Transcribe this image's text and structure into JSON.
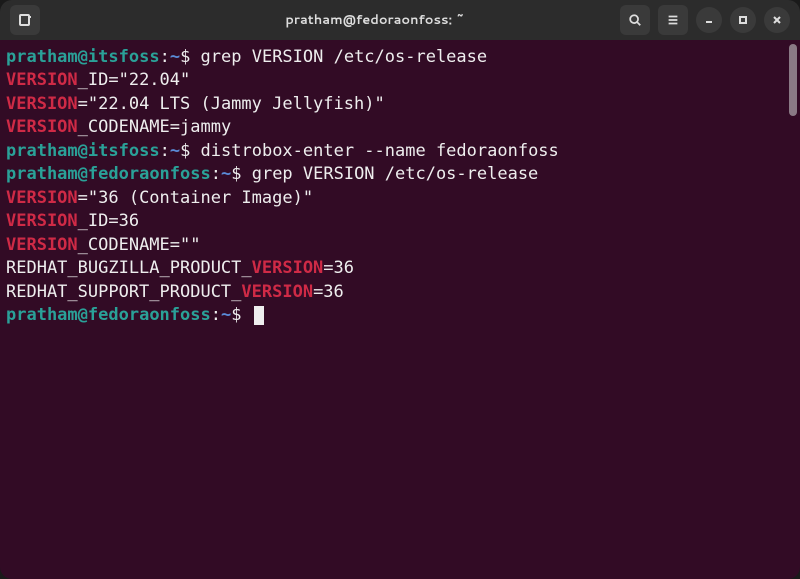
{
  "titlebar": {
    "title": "pratham@fedoraonfoss: ~"
  },
  "prompts": {
    "p1": {
      "user": "pratham",
      "at": "@",
      "host": "itsfoss",
      "colon": ":",
      "path": "~",
      "dollar": "$"
    },
    "p2": {
      "user": "pratham",
      "at": "@",
      "host": "fedoraonfoss",
      "colon": ":",
      "path": "~",
      "dollar": "$"
    }
  },
  "commands": {
    "cmd1": " grep VERSION /etc/os-release",
    "cmd2": " distrobox-enter --name fedoraonfoss",
    "cmd3": " grep VERSION /etc/os-release",
    "cmd4": " "
  },
  "output": {
    "l01a": "VERSION",
    "l01b": "_ID=\"22.04\"",
    "l02a": "VERSION",
    "l02b": "=\"22.04 LTS (Jammy Jellyfish)\"",
    "l03a": "VERSION",
    "l03b": "_CODENAME=jammy",
    "l04a": "VERSION",
    "l04b": "=\"36 (Container Image)\"",
    "l05a": "VERSION",
    "l05b": "_ID=36",
    "l06a": "VERSION",
    "l06b": "_CODENAME=\"\"",
    "l07a": "REDHAT_BUGZILLA_PRODUCT_",
    "l07b": "VERSION",
    "l07c": "=36",
    "l08a": "REDHAT_SUPPORT_PRODUCT_",
    "l08b": "VERSION",
    "l08c": "=36"
  }
}
